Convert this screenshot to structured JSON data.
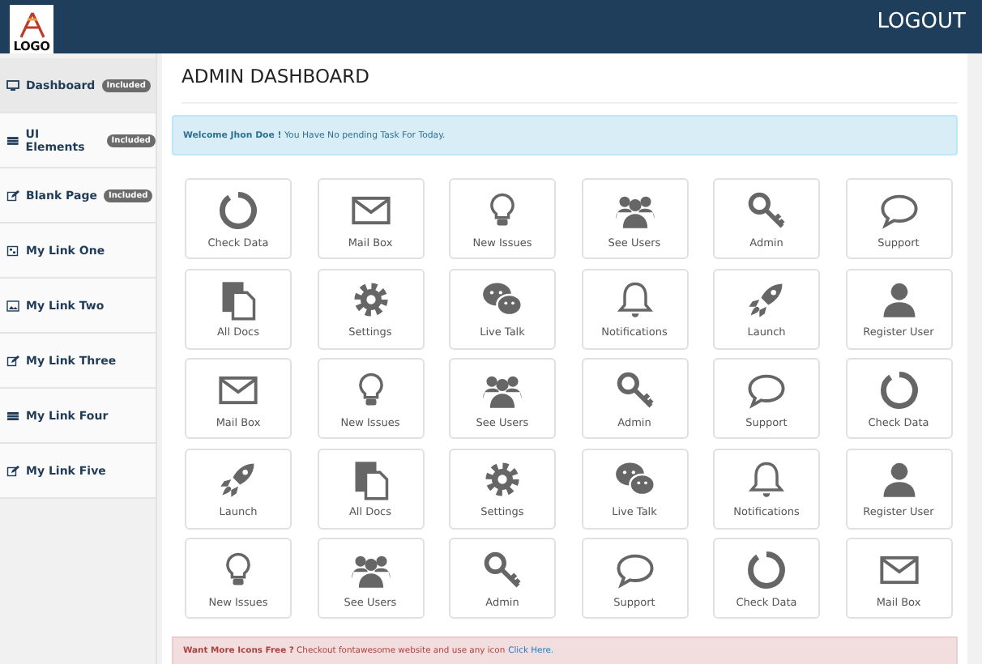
{
  "header": {
    "logo": "LOGO",
    "logout": "LOGOUT"
  },
  "sidebar": {
    "items": [
      {
        "label": "Dashboard",
        "kind": "monitor",
        "badge": "Included",
        "selected": true
      },
      {
        "label": "UI Elements",
        "kind": "table",
        "badge": "Included",
        "selected": false
      },
      {
        "label": "Blank Page",
        "kind": "edit",
        "badge": "Included",
        "selected": false
      },
      {
        "label": "My Link One",
        "kind": "grid",
        "selected": false
      },
      {
        "label": "My Link Two",
        "kind": "image",
        "selected": false
      },
      {
        "label": "My Link Three",
        "kind": "edit",
        "selected": false
      },
      {
        "label": "My Link Four",
        "kind": "table",
        "selected": false
      },
      {
        "label": "My Link Five",
        "kind": "edit",
        "selected": false
      }
    ]
  },
  "title": "ADMIN DASHBOARD",
  "welcome": "**Welcome Jhon Doe !** You Have No pending Task For Today.",
  "tiles": [
    {
      "label": "Check Data",
      "kind": "ring"
    },
    {
      "label": "Mail Box",
      "kind": "envelope"
    },
    {
      "label": "New Issues",
      "kind": "bulb"
    },
    {
      "label": "See Users",
      "kind": "users"
    },
    {
      "label": "Admin",
      "kind": "key"
    },
    {
      "label": "Support",
      "kind": "chat"
    },
    {
      "label": "All Docs",
      "kind": "docs"
    },
    {
      "label": "Settings",
      "kind": "gear"
    },
    {
      "label": "Live Talk",
      "kind": "wechat"
    },
    {
      "label": "Notifications",
      "kind": "bell"
    },
    {
      "label": "Launch",
      "kind": "rocket"
    },
    {
      "label": "Register User",
      "kind": "user"
    },
    {
      "label": "Mail Box",
      "kind": "envelope"
    },
    {
      "label": "New Issues",
      "kind": "bulb"
    },
    {
      "label": "See Users",
      "kind": "users"
    },
    {
      "label": "Admin",
      "kind": "key"
    },
    {
      "label": "Support",
      "kind": "chat"
    },
    {
      "label": "Check Data",
      "kind": "ring"
    },
    {
      "label": "Launch",
      "kind": "rocket"
    },
    {
      "label": "All Docs",
      "kind": "docs"
    },
    {
      "label": "Settings",
      "kind": "gear"
    },
    {
      "label": "Live Talk",
      "kind": "wechat"
    },
    {
      "label": "Notifications",
      "kind": "bell"
    },
    {
      "label": "Register User",
      "kind": "user"
    },
    {
      "label": "New Issues",
      "kind": "bulb"
    },
    {
      "label": "See Users",
      "kind": "users"
    },
    {
      "label": "Admin",
      "kind": "key"
    },
    {
      "label": "Support",
      "kind": "chat"
    },
    {
      "label": "Check Data",
      "kind": "ring"
    },
    {
      "label": "Mail Box",
      "kind": "envelope"
    }
  ],
  "promo": {
    "text": "**Want More Icons Free ?** Checkout fontawesome website and use any icon",
    "link": "Click Here."
  }
}
